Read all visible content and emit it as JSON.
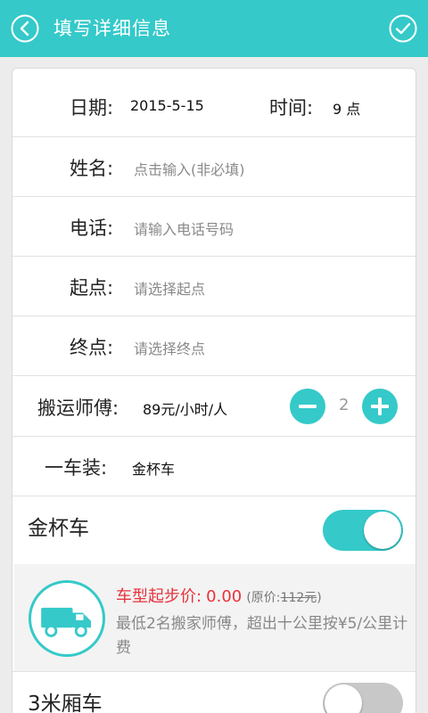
{
  "header": {
    "title": "填写详细信息"
  },
  "date_row": {
    "date_label": "日期:",
    "date_value": "2015-5-15",
    "time_label": "时间:",
    "time_value": "9 点"
  },
  "name_row": {
    "label": "姓名:",
    "placeholder": "点击输入(非必填)"
  },
  "phone_row": {
    "label": "电话:",
    "placeholder": "请输入电话号码"
  },
  "start_row": {
    "label": "起点:",
    "placeholder": "请选择起点"
  },
  "end_row": {
    "label": "终点:",
    "placeholder": "请选择终点"
  },
  "movers_row": {
    "label": "搬运师傅:",
    "price": "89元/小时/人",
    "count": "2"
  },
  "load_row": {
    "label": "一车装:",
    "value": "金杯车"
  },
  "vehicles": [
    {
      "name": "金杯车",
      "enabled": true,
      "price_label": "车型起步价:",
      "price_value": "0.00",
      "orig_prefix": "(原价:",
      "orig_price": "112元",
      "orig_suffix": ")",
      "description": "最低2名搬家师傅，超出十公里按¥5/公里计费"
    },
    {
      "name": "3米厢车",
      "enabled": false
    }
  ],
  "colors": {
    "accent": "#35c9c9",
    "price_red": "#e8323c"
  }
}
